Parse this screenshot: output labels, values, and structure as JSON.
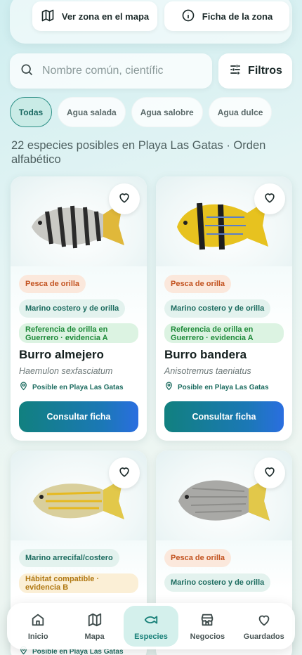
{
  "zone": {
    "map_button": "Ver zona en el mapa",
    "info_button": "Ficha de la zona"
  },
  "search": {
    "placeholder": "Nombre común, científic"
  },
  "filters": {
    "label": "Filtros"
  },
  "chips": [
    "Todas",
    "Agua salada",
    "Agua salobre",
    "Agua dulce"
  ],
  "results_text": "22 especies posibles en Playa Las Gatas · Orden alfabético",
  "cards": [
    {
      "tag_method": "Pesca de orilla",
      "tag_habitat": "Marino costero y de orilla",
      "tag_reference": "Referencia de orilla en Guerrero · evidencia A",
      "name": "Burro almejero",
      "scientific": "Haemulon sexfasciatum",
      "location": "Posible en Playa Las Gatas",
      "cta": "Consultar ficha"
    },
    {
      "tag_method": "Pesca de orilla",
      "tag_habitat": "Marino costero y de orilla",
      "tag_reference": "Referencia de orilla en Guerrero · evidencia A",
      "name": "Burro bandera",
      "scientific": "Anisotremus taeniatus",
      "location": "Posible en Playa Las Gatas",
      "cta": "Consultar ficha"
    },
    {
      "tag_habitat": "Marino arrecifal/costero",
      "tag_reference": "Hábitat compatible · evidencia B",
      "location": "Posible en Playa Las Gatas"
    },
    {
      "tag_method": "Pesca de orilla",
      "tag_habitat": "Marino costero y de orilla"
    }
  ],
  "nav": [
    {
      "label": "Inicio",
      "icon": "home-icon"
    },
    {
      "label": "Mapa",
      "icon": "map-icon"
    },
    {
      "label": "Especies",
      "icon": "fish-icon"
    },
    {
      "label": "Negocios",
      "icon": "store-icon"
    },
    {
      "label": "Guardados",
      "icon": "heart-icon"
    }
  ],
  "colors": {
    "accent": "#177f78",
    "cta_start": "#11807f",
    "cta_end": "#2a6ee0"
  }
}
